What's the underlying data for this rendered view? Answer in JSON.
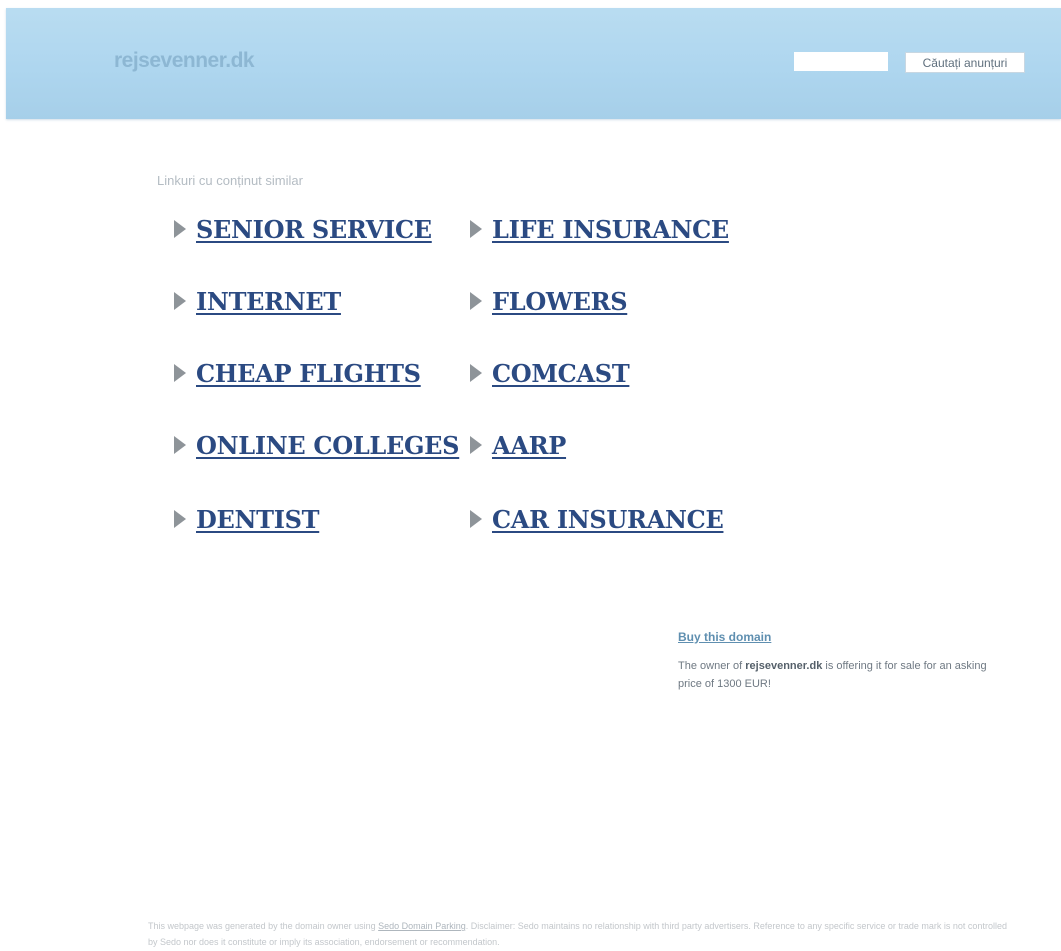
{
  "header": {
    "site_name": "rejsevenner.dk",
    "search_value": "",
    "search_button_label": "Căutați anunțuri"
  },
  "related": {
    "heading": "Linkuri cu conținut similar",
    "links": [
      {
        "label": "SENIOR SERVICE",
        "icon": "arrow-right-icon"
      },
      {
        "label": "LIFE INSURANCE",
        "icon": "arrow-right-icon"
      },
      {
        "label": "INTERNET",
        "icon": "arrow-right-icon"
      },
      {
        "label": "FLOWERS",
        "icon": "arrow-right-icon"
      },
      {
        "label": "CHEAP FLIGHTS",
        "icon": "arrow-right-icon"
      },
      {
        "label": "COMCAST",
        "icon": "arrow-right-icon"
      },
      {
        "label": "ONLINE COLLEGES",
        "icon": "arrow-right-icon"
      },
      {
        "label": "AARP",
        "icon": "arrow-right-icon"
      },
      {
        "label": "DENTIST",
        "icon": "arrow-right-icon"
      },
      {
        "label": "CAR INSURANCE",
        "icon": "arrow-right-icon"
      }
    ]
  },
  "sale": {
    "title": "Buy this domain",
    "text_prefix": "The owner of ",
    "domain": "rejsevenner.dk",
    "text_suffix": " is offering it for sale for an asking price of 1300 EUR!"
  },
  "footer": {
    "text_before_link": "This webpage was generated by the domain owner using ",
    "link_label": "Sedo Domain Parking",
    "text_after_link": ". Disclaimer: Sedo maintains no relationship with third party advertisers. Reference to any specific service or trade mark is not controlled by Sedo nor does it constitute or imply its association, endorsement or recommendation."
  },
  "colors": {
    "header_bg": "#b9dcf1",
    "link": "#2b4a82",
    "arrow": "#8e9499",
    "sale_title": "#5f8fb0"
  }
}
